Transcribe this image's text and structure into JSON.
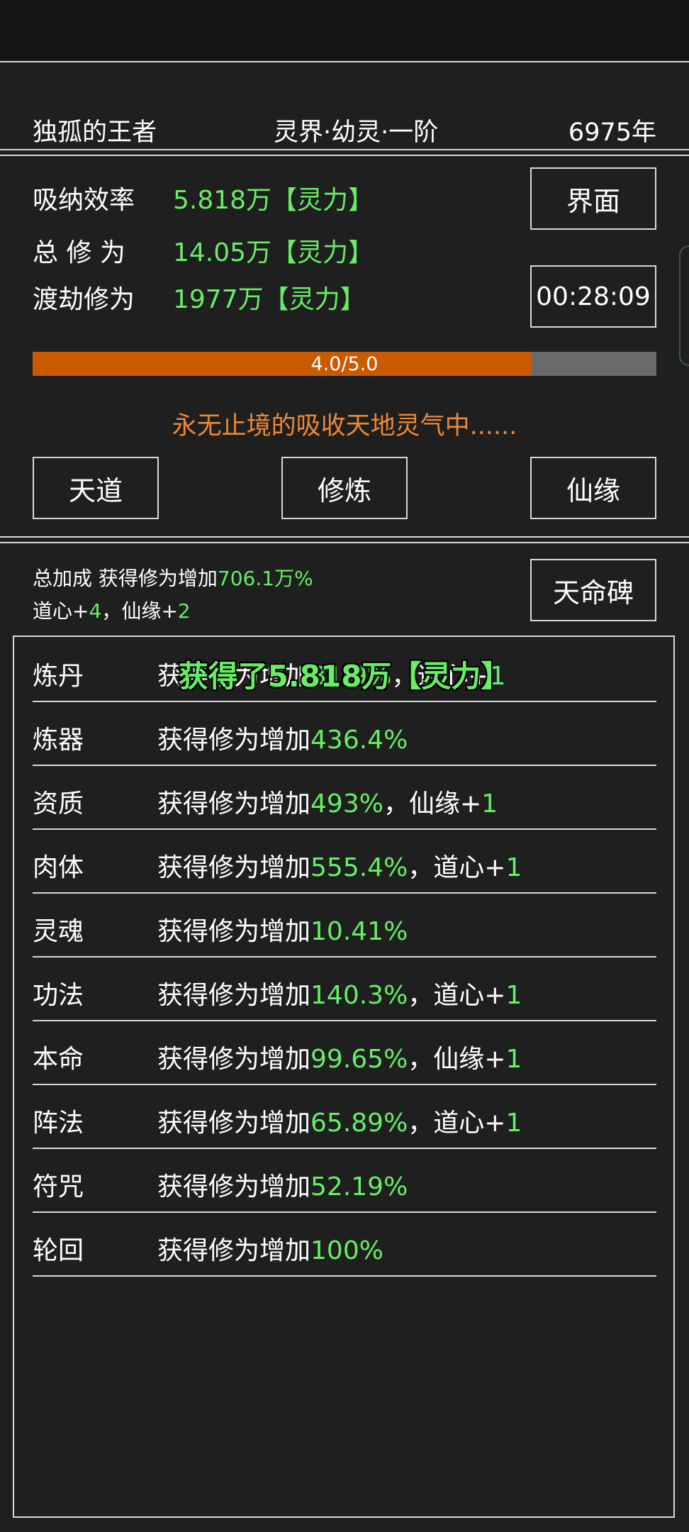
{
  "header": {
    "name": "独孤的王者",
    "realm": "灵界·幼灵·一阶",
    "years": "6975年"
  },
  "stats": [
    {
      "label": "吸纳效率",
      "value": "5.818万【灵力】"
    },
    {
      "label": "总 修 为",
      "value": "14.05万【灵力】"
    },
    {
      "label": "渡劫修为",
      "value": "1977万【灵力】"
    }
  ],
  "buttons": {
    "interface": "界面",
    "timer": "00:28:09",
    "tiandao": "天道",
    "xiulian": "修炼",
    "xianyuan": "仙缘",
    "tianmingbei": "天命碑"
  },
  "progress": {
    "text": "4.0/5.0",
    "value": 4.0,
    "max": 5.0
  },
  "status_text": "永无止境的吸收天地灵气中......",
  "bonus": {
    "line1_label": "总加成 获得修为增加",
    "line1_value": "706.1万%",
    "daoxin_label": "道心+",
    "daoxin_value": "4",
    "sep": "，",
    "xianyuan_label": "仙缘+",
    "xianyuan_value": "2"
  },
  "list": [
    {
      "key": "炼丹",
      "prefix": "获得修为增加",
      "pct": "31.9%",
      "extra_label": "，道心+",
      "extra_value": "1"
    },
    {
      "key": "炼器",
      "prefix": "获得修为增加",
      "pct": "436.4%",
      "extra_label": "",
      "extra_value": ""
    },
    {
      "key": "资质",
      "prefix": "获得修为增加",
      "pct": "493%",
      "extra_label": "，仙缘+",
      "extra_value": "1"
    },
    {
      "key": "肉体",
      "prefix": "获得修为增加",
      "pct": "555.4%",
      "extra_label": "，道心+",
      "extra_value": "1"
    },
    {
      "key": "灵魂",
      "prefix": "获得修为增加",
      "pct": "10.41%",
      "extra_label": "",
      "extra_value": ""
    },
    {
      "key": "功法",
      "prefix": "获得修为增加",
      "pct": "140.3%",
      "extra_label": "，道心+",
      "extra_value": "1"
    },
    {
      "key": "本命",
      "prefix": "获得修为增加",
      "pct": "99.65%",
      "extra_label": "，仙缘+",
      "extra_value": "1"
    },
    {
      "key": "阵法",
      "prefix": "获得修为增加",
      "pct": "65.89%",
      "extra_label": "，道心+",
      "extra_value": "1"
    },
    {
      "key": "符咒",
      "prefix": "获得修为增加",
      "pct": "52.19%",
      "extra_label": "",
      "extra_value": ""
    },
    {
      "key": "轮回",
      "prefix": "获得修为增加",
      "pct": "100%",
      "extra_label": "",
      "extra_value": ""
    }
  ],
  "toast": "获得了5.818万【灵力】",
  "colors": {
    "green": "#66ee66",
    "orange": "#ee8833",
    "progress_fill": "#c85a00"
  }
}
